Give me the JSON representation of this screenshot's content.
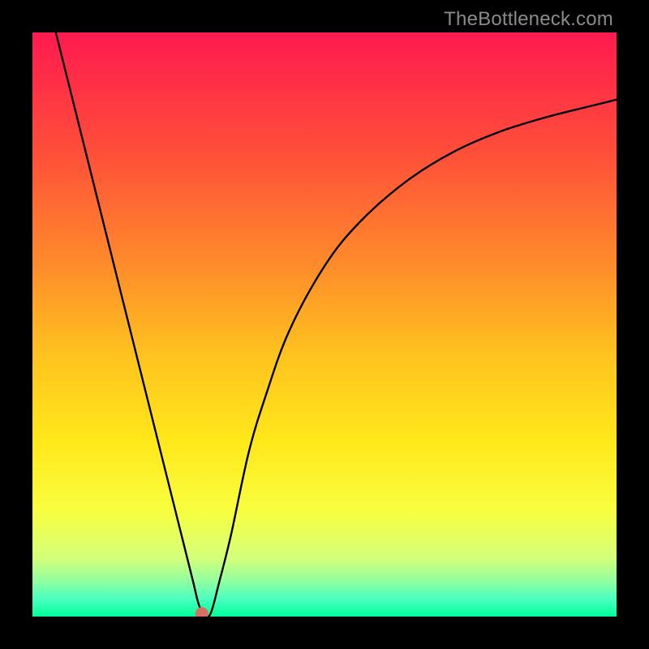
{
  "watermark": "TheBottleneck.com",
  "chart_data": {
    "type": "line",
    "title": "",
    "xlabel": "",
    "ylabel": "",
    "xlim": [
      0,
      100
    ],
    "ylim": [
      0,
      100
    ],
    "grid": false,
    "legend": false,
    "background_gradient": {
      "stops": [
        {
          "offset": 0.0,
          "color": "#ff1a4f"
        },
        {
          "offset": 0.2,
          "color": "#ff4d3a"
        },
        {
          "offset": 0.4,
          "color": "#ff8c2a"
        },
        {
          "offset": 0.55,
          "color": "#ffc21f"
        },
        {
          "offset": 0.7,
          "color": "#ffe81a"
        },
        {
          "offset": 0.82,
          "color": "#f8ff40"
        },
        {
          "offset": 0.9,
          "color": "#d4ff7a"
        },
        {
          "offset": 0.94,
          "color": "#8fffa0"
        },
        {
          "offset": 0.97,
          "color": "#4affc0"
        },
        {
          "offset": 1.0,
          "color": "#00ff99"
        }
      ]
    },
    "series": [
      {
        "name": "bottleneck-curve",
        "x": [
          4.0,
          6.0,
          8.0,
          12.0,
          16.0,
          20.0,
          24.0,
          26.0,
          27.5,
          28.5,
          29.5,
          30.5,
          32.0,
          34.0,
          37.0,
          40.0,
          44.0,
          50.0,
          56.0,
          64.0,
          72.0,
          80.0,
          88.0,
          96.0,
          100.0
        ],
        "y": [
          100.0,
          92.0,
          84.0,
          68.0,
          52.0,
          36.0,
          20.0,
          12.0,
          6.0,
          2.0,
          0.5,
          0.5,
          6.0,
          14.0,
          28.0,
          38.0,
          49.0,
          60.0,
          67.5,
          74.5,
          79.5,
          83.0,
          85.5,
          87.5,
          88.5
        ]
      }
    ],
    "marker": {
      "x": 29.0,
      "y": 0.5,
      "color": "#d6715f",
      "radius_px": 8
    }
  }
}
